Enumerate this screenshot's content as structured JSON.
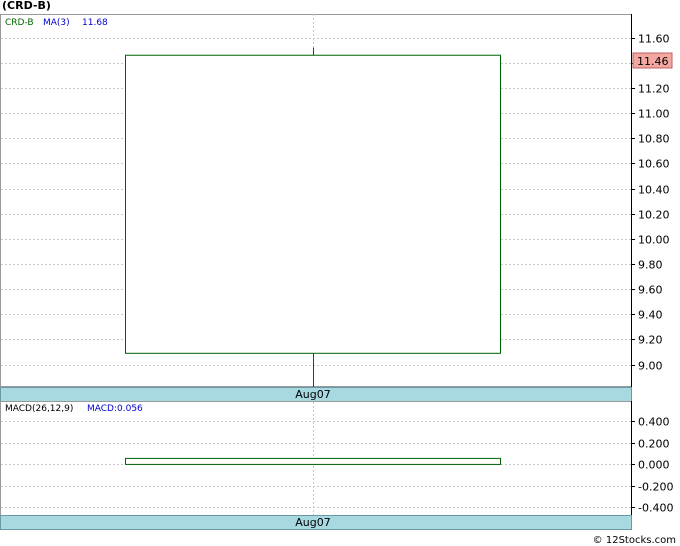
{
  "title": "(CRD-B)",
  "footer": "© 12Stocks.com",
  "colors": {
    "candle": "#006400",
    "ma_label": "#0000cc",
    "ticker_label": "#006400",
    "last_price_bg": "#f4a6a0",
    "date_band": "#a8d8e0",
    "grid": "#c8c8c8"
  },
  "chart_data": [
    {
      "type": "candlestick",
      "ticker": "CRD-B",
      "ma_label": "MA(3)",
      "ma_value": "11.68",
      "last_price": "11.46",
      "ylim": [
        8.83,
        11.78
      ],
      "yticks": [
        "11.60",
        "11.40",
        "11.20",
        "11.00",
        "10.80",
        "10.60",
        "10.40",
        "10.20",
        "10.00",
        "9.80",
        "9.60",
        "9.40",
        "9.20",
        "9.00"
      ],
      "x_label": "Aug07",
      "candles": [
        {
          "date": "Aug07",
          "open": 9.09,
          "close": 11.46,
          "high": 11.52,
          "low": 8.82
        }
      ],
      "grid": true
    },
    {
      "type": "bar",
      "indicator": "MACD(26,12,9)",
      "label": "MACD:0.056",
      "ylim": [
        -0.47,
        0.58
      ],
      "yticks": [
        "0.400",
        "0.200",
        "0.000",
        "-0.200",
        "-0.400"
      ],
      "x_label": "Aug07",
      "values": [
        0.056
      ],
      "grid": true
    }
  ]
}
